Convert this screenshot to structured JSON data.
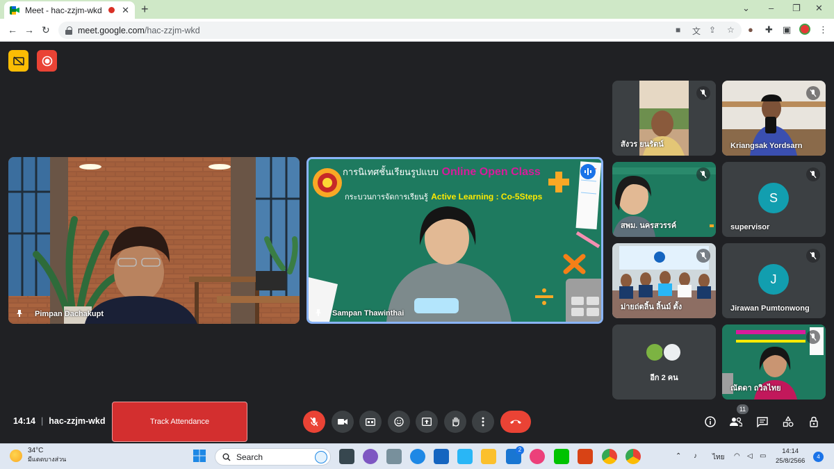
{
  "browser": {
    "tab_title": "Meet - hac-zzjm-wkd",
    "tab_close": "✕",
    "new_tab": "+",
    "url_host": "meet.google.com",
    "url_path": "/hac-zzjm-wkd",
    "window_minimize": "⌄",
    "window_restore": "–",
    "window_maximize": "❐",
    "window_close": "✕"
  },
  "meeting": {
    "time": "14:14",
    "code": "hac-zzjm-wkd",
    "track_attendance_label": "Track Attendance",
    "participants_count": "11",
    "more_people_label": "อีก 2 คน"
  },
  "main_tiles": [
    {
      "name": "Pimpan Dachakupt"
    },
    {
      "name": "Sampan Thawinthai",
      "slide_line1": "การนิเทศชั้นเรียนรูปแบบ",
      "slide_highlight": "Online Open Class",
      "slide_line2": "กระบวนการจัดการเรียนรู้",
      "slide_highlight2": "Active Learning : Co-5Steps"
    }
  ],
  "side_tiles": [
    {
      "name": "สังวร ยนรัตน์"
    },
    {
      "name": "Kriangsak Yordsarn"
    },
    {
      "name": "สพม. นครสวรรค์"
    },
    {
      "name": "supervisor",
      "initial": "S"
    },
    {
      "name": "ม่ายถ่ตลิ้น ลิ้นม์ ตั้ง"
    },
    {
      "name": "Jirawan Pumtonwong",
      "initial": "J"
    },
    {
      "name": "ณัตดา ถวิลไทย"
    }
  ],
  "taskbar": {
    "temperature": "34°C",
    "weather_text": "มีแดดบางส่วน",
    "search_label": "Search",
    "language": "ไทย",
    "clock_time": "14:14",
    "clock_date": "25/8/2566",
    "notification_count": "4",
    "mail_badge": "2"
  },
  "colors": {
    "meet_bg": "#202124",
    "tile_bg": "#3c4043",
    "end_call": "#ea4335",
    "avatar_teal": "#129eaf",
    "active_border": "#8ab4f8",
    "slide_green": "#1e7a5f",
    "slide_magenta": "#d81b9c",
    "slide_yellow": "#ffea00"
  }
}
